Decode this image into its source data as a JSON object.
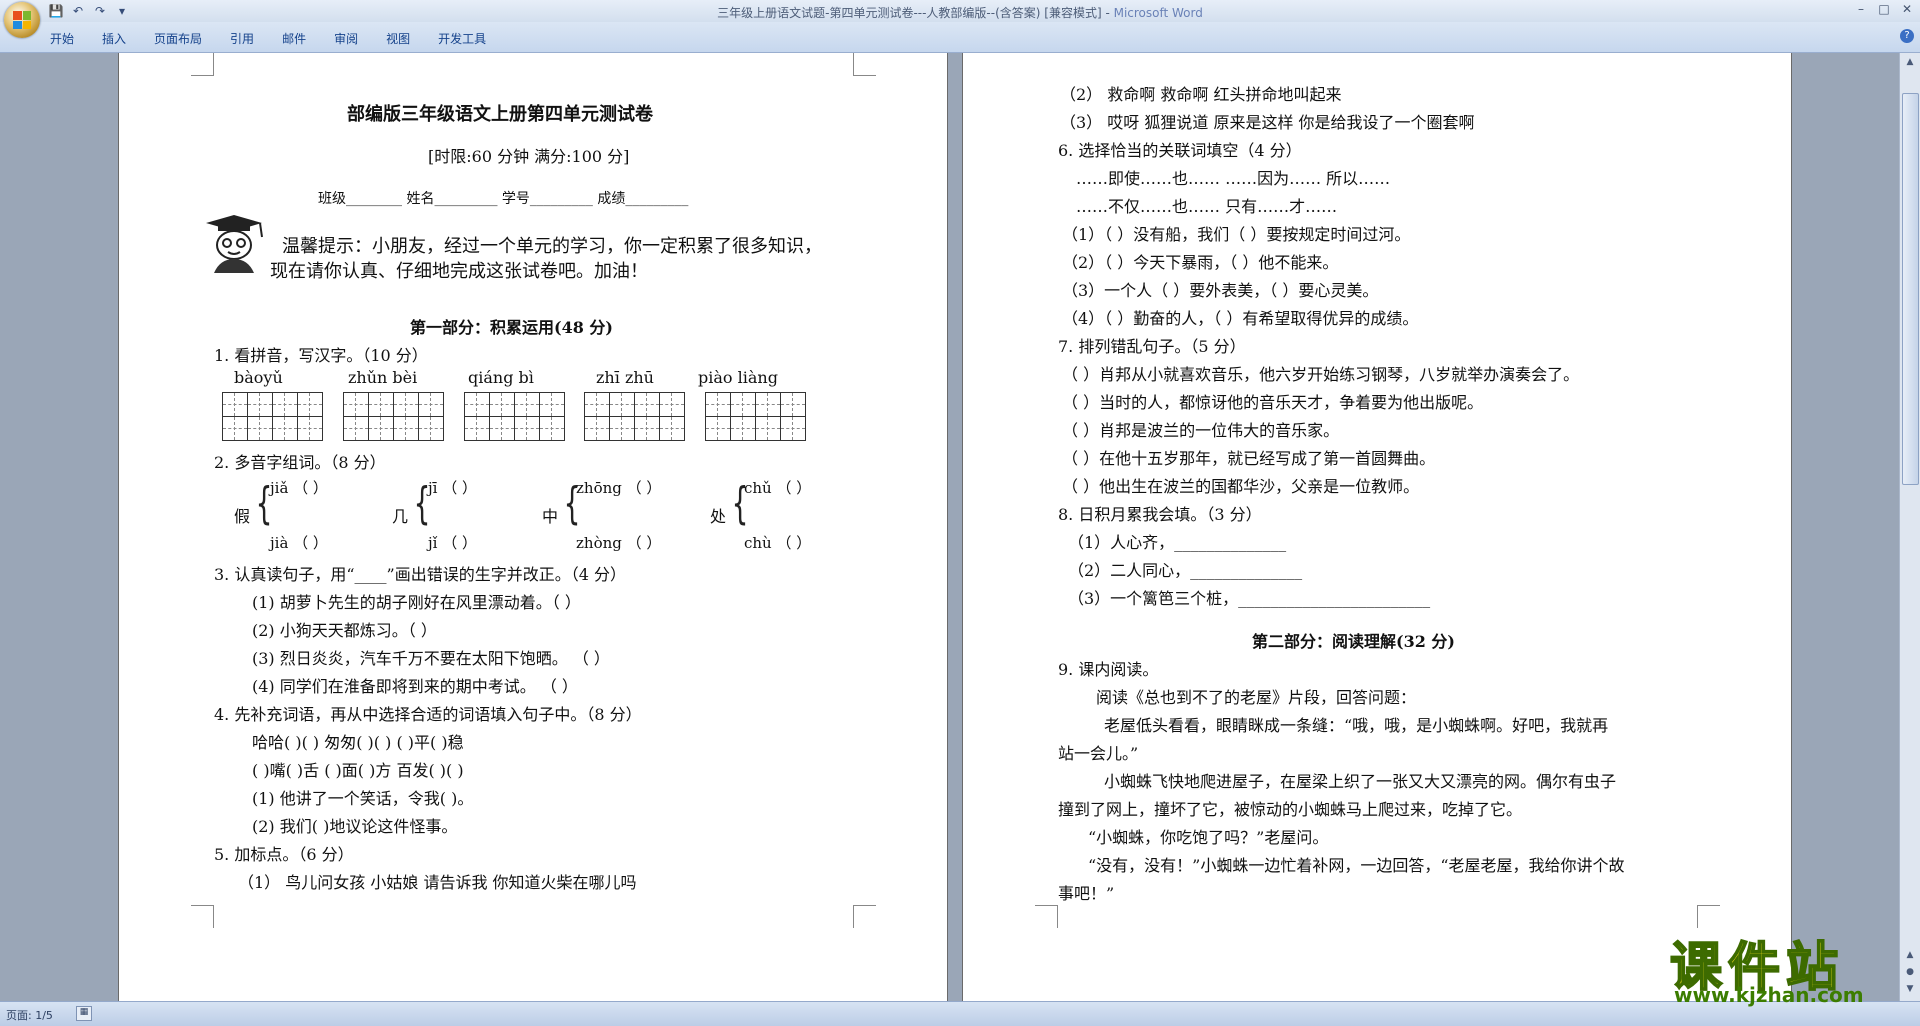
{
  "window": {
    "title": "三年级上册语文试题-第四单元测试卷---人教部编版--(含答案) [兼容模式] - ",
    "app_name": "Microsoft Word",
    "minimize": "–",
    "maximize": "□",
    "close": "✕"
  },
  "qat": {
    "save": "💾",
    "undo": "↶",
    "redo": "↷",
    "more": "▾"
  },
  "ribbon": {
    "tabs": [
      "开始",
      "插入",
      "页面布局",
      "引用",
      "邮件",
      "审阅",
      "视图",
      "开发工具"
    ],
    "help": "?"
  },
  "status": {
    "page": "页面: 1/5"
  },
  "watermark": {
    "text": "课件站",
    "url": "www.kjzhan.com"
  },
  "page1": {
    "title": "部编版三年级语文上册第四单元测试卷",
    "time": "[时限:60 分钟     满分:100 分]",
    "fields": "班级________   姓名_________   学号_________   成绩_________",
    "tip_line1": "温馨提示：小朋友，经过一个单元的学习，你一定积累了很多知识，",
    "tip_line2": "现在请你认真、仔细地完成这张试卷吧。加油！",
    "part1": "第一部分：积累运用(48 分)",
    "q1": "1. 看拼音，写汉字。（10 分）",
    "pinyin": [
      "bàoyǔ",
      "zhǔn bèi",
      "qiáng bì",
      "zhī zhū",
      "piào liàng"
    ],
    "q2": "2. 多音字组词。（8 分）",
    "poly": [
      {
        "char": "假",
        "r1": "jiǎ  （     ）",
        "r2": "jià  （     ）"
      },
      {
        "char": "几",
        "r1": "jī  （     ）",
        "r2": "jǐ  （     ）"
      },
      {
        "char": "中",
        "r1": "zhōng  （     ）",
        "r2": "zhòng  （     ）"
      },
      {
        "char": "处",
        "r1": "chǔ （     ）",
        "r2": "chù （     ）"
      }
    ],
    "q3": "3. 认真读句子，用“____”画出错误的生字并改正。（4 分）",
    "q3_items": [
      "(1) 胡萝卜先生的胡子刚好在风里漂动着。（     ）",
      "(2) 小狗天天都炼习。（     ）",
      "(3) 烈日炎炎，汽车千万不要在太阳下饱晒。     （     ）",
      "(4) 同学们在淮备即将到来的期中考试。     （     ）"
    ],
    "q4": "4. 先补充词语，再从中选择合适的词语填入句子中。（8 分）",
    "q4_row1": "哈哈(     )(     )     匆匆(     )(     )     (     )平(     )稳",
    "q4_row2": "(     )嘴(     )舌     (     )面(     )方     百发(     )(     )",
    "q4_s1": "(1) 他讲了一个笑话，令我(               )。",
    "q4_s2": "(2) 我们(               )地议论这件怪事。",
    "q5": "5. 加标点。（6 分）",
    "q5_1": "（1）  鸟儿问女孩      小姑娘      请告诉我      你知道火柴在哪儿吗"
  },
  "page2": {
    "q5_2": "（2）  救命啊      救命啊      红头拼命地叫起来",
    "q5_3": "（3）  哎呀      狐狸说道      原来是这样      你是给我设了一个圈套啊",
    "q6": "6. 选择恰当的关联词填空（4 分）",
    "q6_opts1": "……即使……也……          ……因为…… 所以……",
    "q6_opts2": "……不仅……也……          只有……才……",
    "q6_items": [
      "（1）（       ）没有船，我们（       ）要按规定时间过河。",
      "（2）（       ）今天下暴雨，（       ）他不能来。",
      "（3）一个人（       ）要外表美，（       ）要心灵美。",
      "（4）（       ）勤奋的人，（       ）有希望取得优异的成绩。"
    ],
    "q7": "7. 排列错乱句子。（5 分）",
    "q7_items": [
      "（ ）肖邦从小就喜欢音乐，他六岁开始练习钢琴，八岁就举办演奏会了。",
      "（ ）当时的人，都惊讶他的音乐天才，争着要为他出版呢。",
      "（ ）肖邦是波兰的一位伟大的音乐家。",
      "（ ）在他十五岁那年，就已经写成了第一首圆舞曲。",
      "（ ）他出生在波兰的国都华沙，父亲是一位教师。"
    ],
    "q8": "8. 日积月累我会填。（3 分）",
    "q8_items": [
      "（1）人心齐，______________",
      "（2）二人同心，______________",
      "（3）一个篱笆三个桩，________________________"
    ],
    "part2": "第二部分：阅读理解(32 分)",
    "q9": "9. 课内阅读。",
    "q9_intro": "阅读《总也到不了的老屋》片段，回答问题：",
    "q9_p1a": "老屋低头看看，眼睛眯成一条缝：“哦，哦，是小蜘蛛啊。好吧，我就再",
    "q9_p1b": "站一会儿。”",
    "q9_p2a": "小蜘蛛飞快地爬进屋子，在屋梁上织了一张又大又漂亮的网。偶尔有虫子",
    "q9_p2b": "撞到了网上，撞坏了它，被惊动的小蜘蛛马上爬过来，吃掉了它。",
    "q9_p3": "“小蜘蛛，你吃饱了吗？”老屋问。",
    "q9_p4a": "“没有，没有！”小蜘蛛一边忙着补网，一边回答，“老屋老屋，我给你讲个故",
    "q9_p4b": "事吧！”"
  }
}
